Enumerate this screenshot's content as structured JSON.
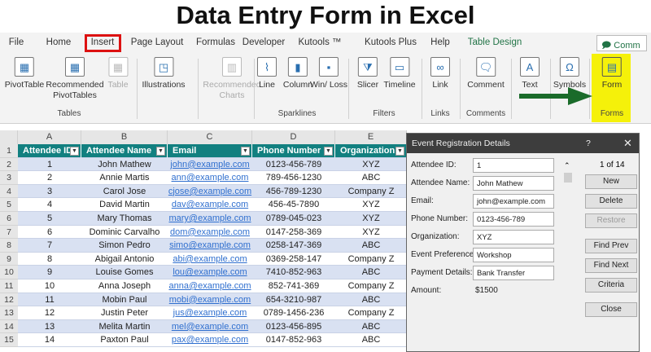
{
  "title": "Data Entry Form in Excel",
  "tabs": [
    "File",
    "Home",
    "Insert",
    "Page Layout",
    "Formulas",
    "Developer",
    "Kutools ™",
    "Kutools Plus",
    "Help",
    "Table Design"
  ],
  "active_tab": "Insert",
  "comments_button": "Comm",
  "ribbon": {
    "items": [
      {
        "label": "PivotTable",
        "icon": "pivot-table-icon"
      },
      {
        "label": "Recommended PivotTables",
        "icon": "recommended-pivot-icon"
      },
      {
        "label": "Table",
        "icon": "table-icon",
        "disabled": true
      },
      {
        "label": "Illustrations",
        "icon": "illustrations-icon"
      },
      {
        "label": "Recommended Charts",
        "icon": "recommended-charts-icon",
        "disabled": true
      },
      {
        "label": "Line",
        "icon": "line-sparkline-icon"
      },
      {
        "label": "Column",
        "icon": "column-sparkline-icon"
      },
      {
        "label": "Win/ Loss",
        "icon": "winloss-sparkline-icon"
      },
      {
        "label": "Slicer",
        "icon": "slicer-icon"
      },
      {
        "label": "Timeline",
        "icon": "timeline-icon"
      },
      {
        "label": "Link",
        "icon": "link-icon"
      },
      {
        "label": "Comment",
        "icon": "comment-icon"
      },
      {
        "label": "Text",
        "icon": "text-icon"
      },
      {
        "label": "Symbols",
        "icon": "omega-icon"
      },
      {
        "label": "Form",
        "icon": "form-icon"
      }
    ],
    "groups": [
      "Tables",
      "Sparklines",
      "Filters",
      "Links",
      "Comments",
      "Forms"
    ],
    "highlight_color": "#f5f10a",
    "arrow_color": "#1a6b2a"
  },
  "sheet": {
    "columns": [
      "A",
      "B",
      "C",
      "D",
      "E"
    ],
    "headers": [
      "Attendee ID",
      "Attendee Name",
      "Email",
      "Phone Number",
      "Organization"
    ],
    "header_color": "#128080",
    "rows": [
      [
        "1",
        "John Mathew",
        "john@example.com",
        "0123-456-789",
        "XYZ"
      ],
      [
        "2",
        "Annie Martis",
        "ann@example.com",
        "789-456-1230",
        "ABC"
      ],
      [
        "3",
        "Carol Jose",
        "cjose@example.com",
        "456-789-1230",
        "Company Z"
      ],
      [
        "4",
        "David Martin",
        "dav@example.com",
        "456-45-7890",
        "XYZ"
      ],
      [
        "5",
        "Mary Thomas",
        "mary@example.com",
        "0789-045-023",
        "XYZ"
      ],
      [
        "6",
        "Dominic  Carvalho",
        "dom@example.com",
        "0147-258-369",
        "XYZ"
      ],
      [
        "7",
        "Simon Pedro",
        "simo@example.com",
        "0258-147-369",
        "ABC"
      ],
      [
        "8",
        "Abigail Antonio",
        "abi@example.com",
        "0369-258-147",
        "Company Z"
      ],
      [
        "9",
        "Louise Gomes",
        "lou@example.com",
        "7410-852-963",
        "ABC"
      ],
      [
        "10",
        "Anna Joseph",
        "anna@example.com",
        "852-741-369",
        "Company Z"
      ],
      [
        "11",
        "Mobin Paul",
        "mobi@example.com",
        "654-3210-987",
        "ABC"
      ],
      [
        "12",
        "Justin Peter",
        "jus@example.com",
        "0789-1456-236",
        "Company Z"
      ],
      [
        "13",
        "Melita Martin",
        "mel@example.com",
        "0123-456-895",
        "ABC"
      ],
      [
        "14",
        "Paxton Paul",
        "pax@example.com",
        "0147-852-963",
        "ABC"
      ]
    ]
  },
  "dialog": {
    "title": "Event Registration Details",
    "help": "?",
    "close": "✕",
    "fields": [
      {
        "label": "Attendee ID:",
        "value": "1"
      },
      {
        "label": "Attendee Name:",
        "value": "John Mathew"
      },
      {
        "label": "Email:",
        "value": "john@example.com"
      },
      {
        "label": "Phone Number:",
        "value": "0123-456-789"
      },
      {
        "label": "Organization:",
        "value": "XYZ"
      },
      {
        "label": "Event Preference:",
        "value": "Workshop"
      },
      {
        "label": "Payment Details:",
        "value": "Bank Transfer"
      }
    ],
    "amount_label": "Amount:",
    "amount_value": "$1500",
    "record": "1 of 14",
    "buttons": [
      "New",
      "Delete",
      "Restore",
      "Find Prev",
      "Find Next",
      "Criteria",
      "Close"
    ]
  }
}
